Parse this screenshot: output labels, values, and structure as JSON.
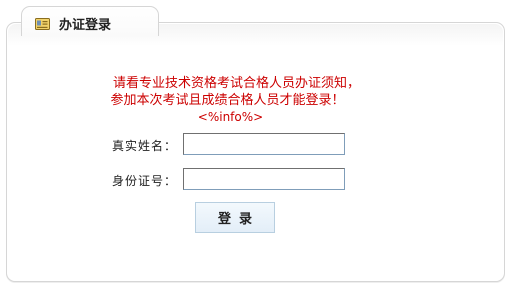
{
  "header": {
    "title": "办证登录",
    "icon": "certificate-card-icon"
  },
  "notice": {
    "line1": "请看专业技术资格考试合格人员办证须知，",
    "line2": "参加本次考试且成绩合格人员才能登录！",
    "line3": "<%info%>"
  },
  "form": {
    "name_label": "真实姓名：",
    "name_value": "",
    "id_label": "身份证号：",
    "id_value": "",
    "submit_label": "登录"
  },
  "colors": {
    "notice": "#cc0000",
    "border": "#d6d6d6",
    "button_bg": "#e8f2fa"
  }
}
